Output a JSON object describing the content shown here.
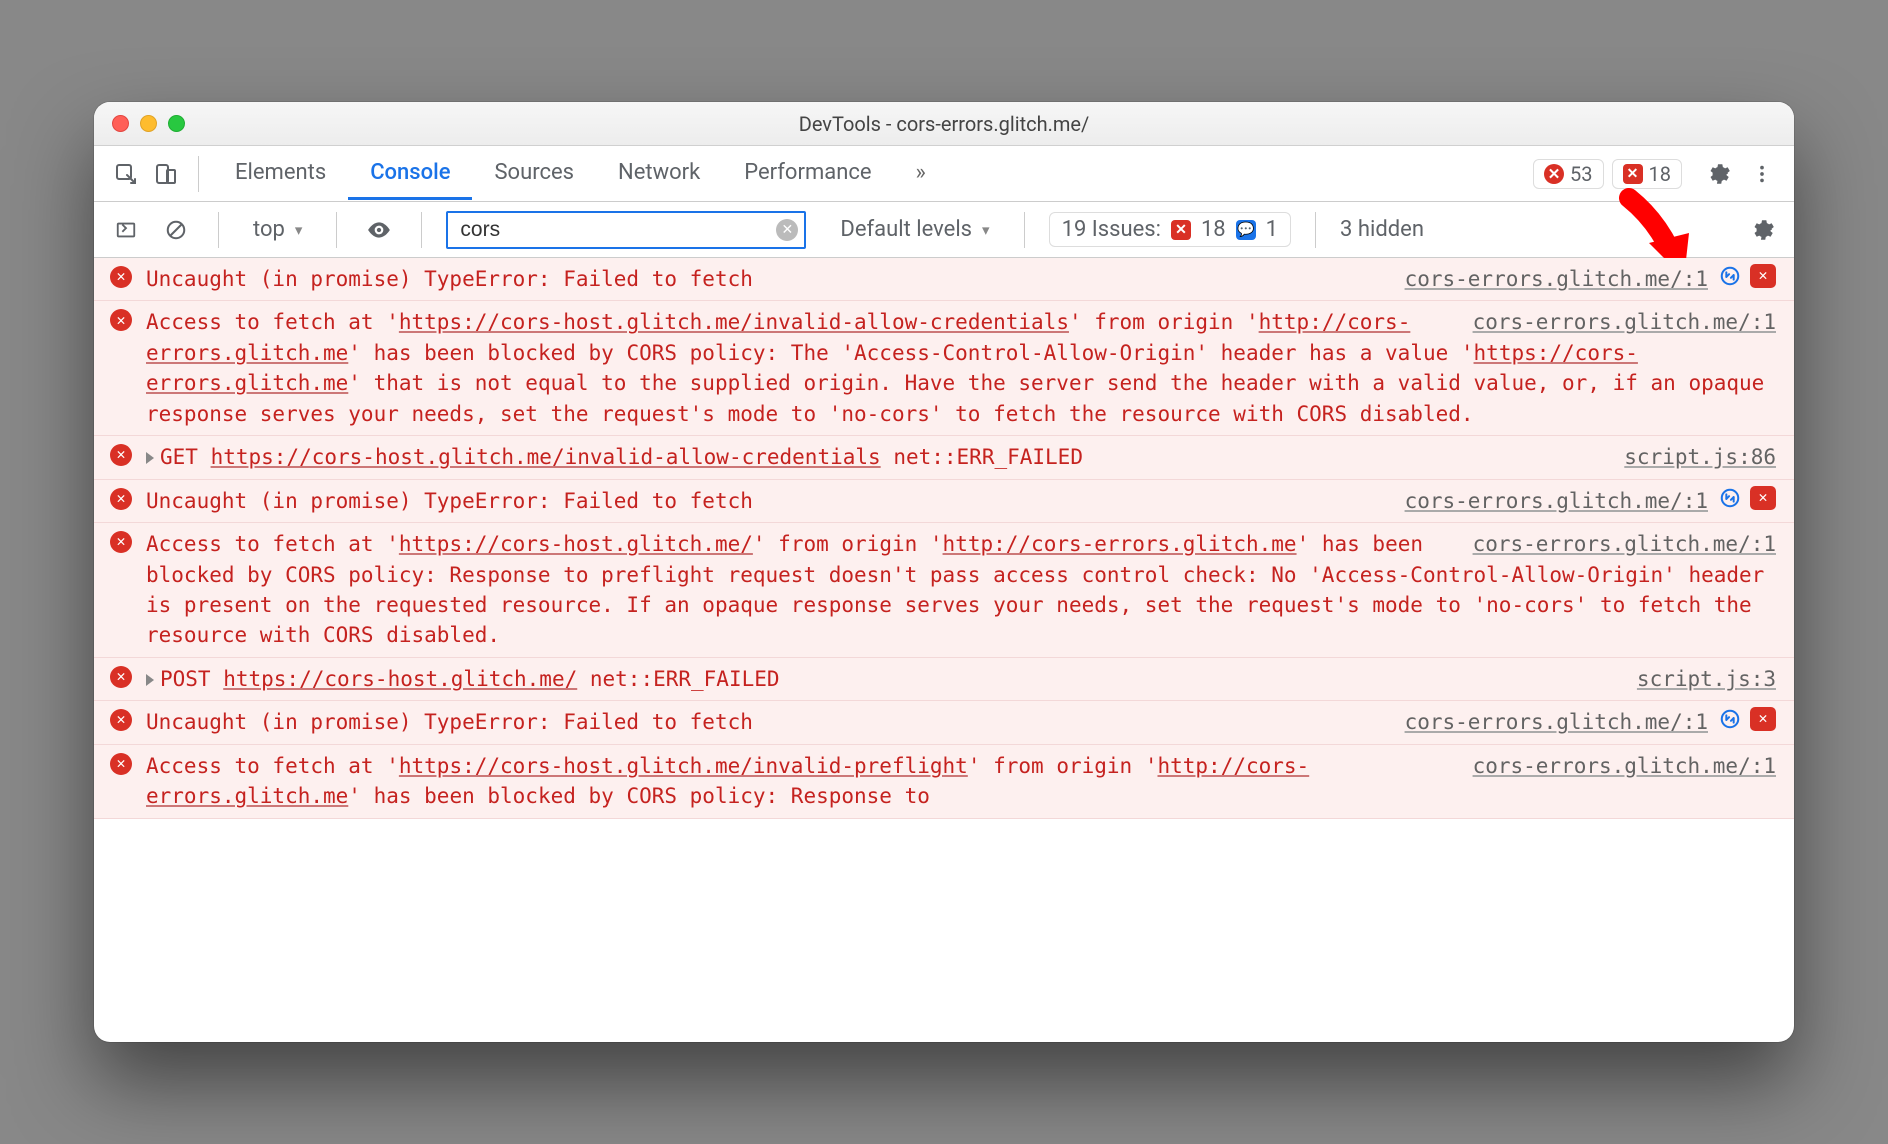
{
  "window": {
    "title": "DevTools - cors-errors.glitch.me/"
  },
  "tabs": {
    "items": [
      "Elements",
      "Console",
      "Sources",
      "Network",
      "Performance"
    ],
    "active_index": 1,
    "overflow": "»"
  },
  "counts": {
    "errors": "53",
    "warnings": "18"
  },
  "filter": {
    "context": "top",
    "input_value": "cors",
    "levels": "Default levels",
    "issues_label": "19 Issues:",
    "issues_errors": "18",
    "issues_msgs": "1",
    "hidden": "3 hidden"
  },
  "messages": [
    {
      "type": "error",
      "text": "Uncaught (in promise) TypeError: Failed to fetch",
      "source": "cors-errors.glitch.me/:1",
      "actions": true
    },
    {
      "type": "error",
      "text_segments": [
        {
          "t": "Access to fetch at '"
        },
        {
          "t": "https://cors-host.glitch.me/invalid-allow-credentials",
          "link": true
        },
        {
          "t": "' from origin '"
        },
        {
          "t": "http://cors-errors.glitch.me",
          "link": true
        },
        {
          "t": "' has been blocked by CORS policy: The 'Access-Control-Allow-Origin' header has a value '"
        },
        {
          "t": "https://cors-errors.glitch.me",
          "link": true
        },
        {
          "t": "' that is not equal to the supplied origin. Have the server send the header with a valid value, or, if an opaque response serves your needs, set the request's mode to 'no-cors' to fetch the resource with CORS disabled."
        }
      ],
      "source": "cors-errors.glitch.me/:1"
    },
    {
      "type": "net-error",
      "expandable": true,
      "method": "GET",
      "url": "https://cors-host.glitch.me/invalid-allow-credentials",
      "status": "net::ERR_FAILED",
      "source": "script.js:86"
    },
    {
      "type": "error",
      "text": "Uncaught (in promise) TypeError: Failed to fetch",
      "source": "cors-errors.glitch.me/:1",
      "actions": true
    },
    {
      "type": "error",
      "text_segments": [
        {
          "t": "Access to fetch at '"
        },
        {
          "t": "https://cors-host.glitch.me/",
          "link": true
        },
        {
          "t": "' from origin '"
        },
        {
          "t": "http://cors-errors.glitch.me",
          "link": true
        },
        {
          "t": "' has been blocked by CORS policy: Response to preflight request doesn't pass access control check: No 'Access-Control-Allow-Origin' header is present on the requested resource. If an opaque response serves your needs, set the request's mode to 'no-cors' to fetch the resource with CORS disabled."
        }
      ],
      "source": "cors-errors.glitch.me/:1"
    },
    {
      "type": "net-error",
      "expandable": true,
      "method": "POST",
      "url": "https://cors-host.glitch.me/",
      "status": "net::ERR_FAILED",
      "source": "script.js:3"
    },
    {
      "type": "error",
      "text": "Uncaught (in promise) TypeError: Failed to fetch",
      "source": "cors-errors.glitch.me/:1",
      "actions": true
    },
    {
      "type": "error",
      "text_segments": [
        {
          "t": "Access to fetch at '"
        },
        {
          "t": "https://cors-host.glitch.me/invalid-preflight",
          "link": true
        },
        {
          "t": "' from origin '"
        },
        {
          "t": "http://cors-errors.glitch.me",
          "link": true
        },
        {
          "t": "' has been blocked by CORS policy: Response to"
        }
      ],
      "source": "cors-errors.glitch.me/:1"
    }
  ]
}
